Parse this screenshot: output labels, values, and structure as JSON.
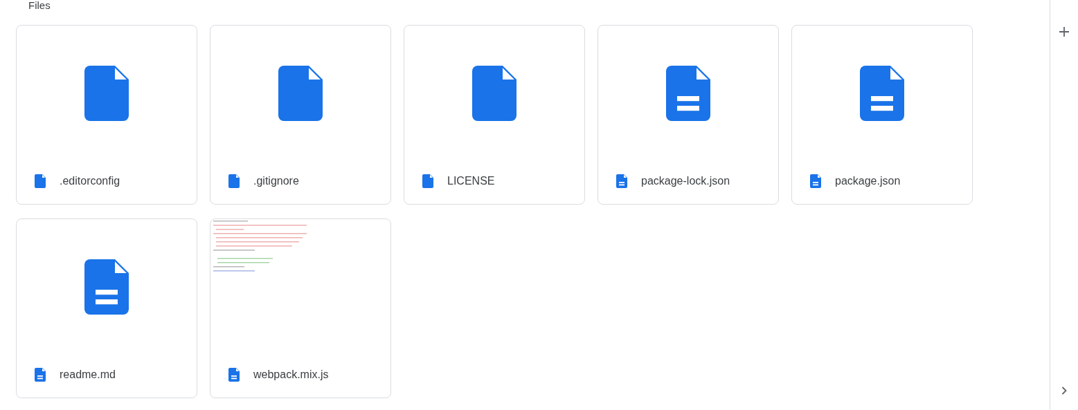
{
  "section_title": "Files",
  "files": [
    {
      "name": ".editorconfig",
      "kind": "file"
    },
    {
      "name": ".gitignore",
      "kind": "file"
    },
    {
      "name": "LICENSE",
      "kind": "file"
    },
    {
      "name": "package-lock.json",
      "kind": "document"
    },
    {
      "name": "package.json",
      "kind": "document"
    },
    {
      "name": "readme.md",
      "kind": "document"
    },
    {
      "name": "webpack.mix.js",
      "kind": "document"
    }
  ]
}
